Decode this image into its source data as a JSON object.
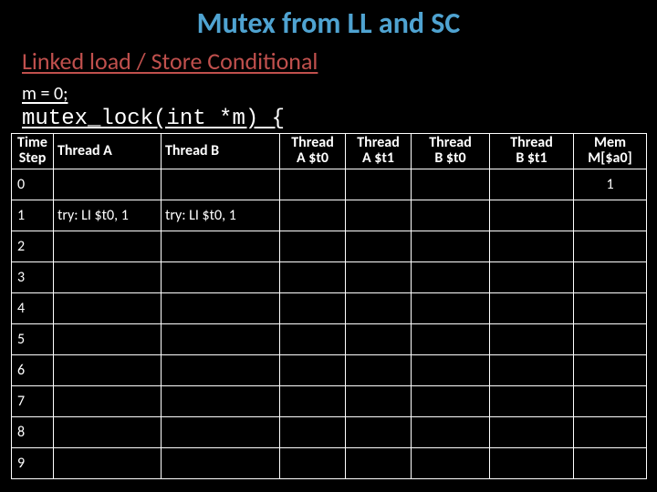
{
  "title": "Mutex from LL and SC",
  "subtitle": "Linked load / Store Conditional",
  "codeline1": "m = 0;",
  "codeline2": "mutex_lock(int *m) {",
  "headers": {
    "c0a": "Time",
    "c0b": "Step",
    "c1": "Thread A",
    "c2": "Thread B",
    "c3a": "Thread",
    "c3b": "A $t0",
    "c4a": "Thread",
    "c4b": "A $t1",
    "c5a": "Thread",
    "c5b": "B $t0",
    "c6a": "Thread",
    "c6b": "B $t1",
    "c7a": "Mem",
    "c7b": "M[$a0]"
  },
  "rows": [
    {
      "step": "0",
      "a": "",
      "b": "",
      "at0": "",
      "at1": "",
      "bt0": "",
      "bt1": "",
      "mem": "1"
    },
    {
      "step": "1",
      "a": "try: LI $t0, 1",
      "b": "try: LI $t0, 1",
      "at0": "",
      "at1": "",
      "bt0": "",
      "bt1": "",
      "mem": ""
    },
    {
      "step": "2",
      "a": "",
      "b": "",
      "at0": "",
      "at1": "",
      "bt0": "",
      "bt1": "",
      "mem": ""
    },
    {
      "step": "3",
      "a": "",
      "b": "",
      "at0": "",
      "at1": "",
      "bt0": "",
      "bt1": "",
      "mem": ""
    },
    {
      "step": "4",
      "a": "",
      "b": "",
      "at0": "",
      "at1": "",
      "bt0": "",
      "bt1": "",
      "mem": ""
    },
    {
      "step": "5",
      "a": "",
      "b": "",
      "at0": "",
      "at1": "",
      "bt0": "",
      "bt1": "",
      "mem": ""
    },
    {
      "step": "6",
      "a": "",
      "b": "",
      "at0": "",
      "at1": "",
      "bt0": "",
      "bt1": "",
      "mem": ""
    },
    {
      "step": "7",
      "a": "",
      "b": "",
      "at0": "",
      "at1": "",
      "bt0": "",
      "bt1": "",
      "mem": ""
    },
    {
      "step": "8",
      "a": "",
      "b": "",
      "at0": "",
      "at1": "",
      "bt0": "",
      "bt1": "",
      "mem": ""
    },
    {
      "step": "9",
      "a": "",
      "b": "",
      "at0": "",
      "at1": "",
      "bt0": "",
      "bt1": "",
      "mem": ""
    }
  ],
  "chart_data": {
    "type": "table",
    "title": "Mutex from LL and SC — execution trace",
    "columns": [
      "Time Step",
      "Thread A",
      "Thread B",
      "Thread A $t0",
      "Thread A $t1",
      "Thread B $t0",
      "Thread B $t1",
      "Mem M[$a0]"
    ],
    "rows": [
      [
        "0",
        "",
        "",
        "",
        "",
        "",
        "",
        "1"
      ],
      [
        "1",
        "try: LI $t0, 1",
        "try: LI $t0, 1",
        "",
        "",
        "",
        "",
        ""
      ],
      [
        "2",
        "",
        "",
        "",
        "",
        "",
        "",
        ""
      ],
      [
        "3",
        "",
        "",
        "",
        "",
        "",
        "",
        ""
      ],
      [
        "4",
        "",
        "",
        "",
        "",
        "",
        "",
        ""
      ],
      [
        "5",
        "",
        "",
        "",
        "",
        "",
        "",
        ""
      ],
      [
        "6",
        "",
        "",
        "",
        "",
        "",
        "",
        ""
      ],
      [
        "7",
        "",
        "",
        "",
        "",
        "",
        "",
        ""
      ],
      [
        "8",
        "",
        "",
        "",
        "",
        "",
        "",
        ""
      ],
      [
        "9",
        "",
        "",
        "",
        "",
        "",
        "",
        ""
      ]
    ]
  }
}
